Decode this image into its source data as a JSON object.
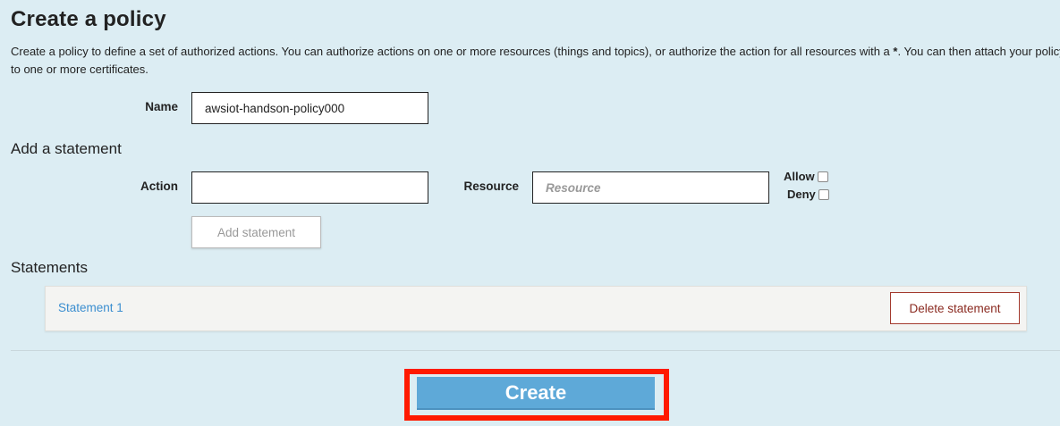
{
  "page": {
    "title": "Create a policy",
    "description_before": "Create a policy to define a set of authorized actions. You can authorize actions on one or more resources (things and topics), or authorize the action for all resources with a ",
    "description_wildcard": "*",
    "description_after": ". You can then attach your policy to one or more certificates."
  },
  "name_field": {
    "label": "Name",
    "value": "awsiot-handson-policy000"
  },
  "add_statement": {
    "heading": "Add a statement",
    "action_label": "Action",
    "action_value": "",
    "resource_label": "Resource",
    "resource_placeholder": "Resource",
    "allow_label": "Allow",
    "deny_label": "Deny",
    "allow_checked": false,
    "deny_checked": false,
    "button_label": "Add statement"
  },
  "statements": {
    "heading": "Statements",
    "items": [
      {
        "label": "Statement 1",
        "delete_label": "Delete statement"
      }
    ]
  },
  "footer": {
    "create_label": "Create"
  },
  "colors": {
    "background": "#dcedf3",
    "primary_button": "#5ea9d8",
    "highlight": "#ff1a00",
    "link": "#3b8ed0",
    "danger": "#8a2a20"
  }
}
